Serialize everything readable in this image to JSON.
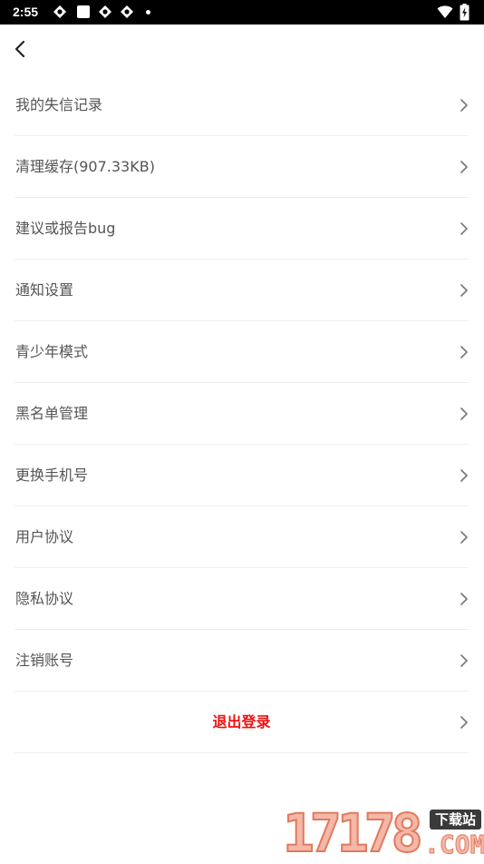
{
  "status_bar": {
    "time": "2:55",
    "notification_icons": [
      "app-notification-icon",
      "square-notification-icon",
      "app-notification-icon",
      "app-notification-icon"
    ],
    "wifi_icon": "wifi-icon",
    "battery_icon": "battery-charging-icon"
  },
  "header": {
    "back_icon": "chevron-left-icon"
  },
  "settings": {
    "items": [
      {
        "label": "我的失信记录"
      },
      {
        "label": "清理缓存(907.33KB)"
      },
      {
        "label": "建议或报告bug"
      },
      {
        "label": "通知设置"
      },
      {
        "label": "青少年模式"
      },
      {
        "label": "黑名单管理"
      },
      {
        "label": "更换手机号"
      },
      {
        "label": "用户协议"
      },
      {
        "label": "隐私协议"
      },
      {
        "label": "注销账号"
      }
    ],
    "logout_label": "退出登录",
    "chevron_icon": "chevron-right-icon"
  },
  "colors": {
    "logout_text": "#ee1111",
    "item_text": "#555555",
    "divider": "#eeeeee"
  },
  "watermark": {
    "digits": "17178",
    "tag": "下载站",
    "suffix": ".COM"
  }
}
